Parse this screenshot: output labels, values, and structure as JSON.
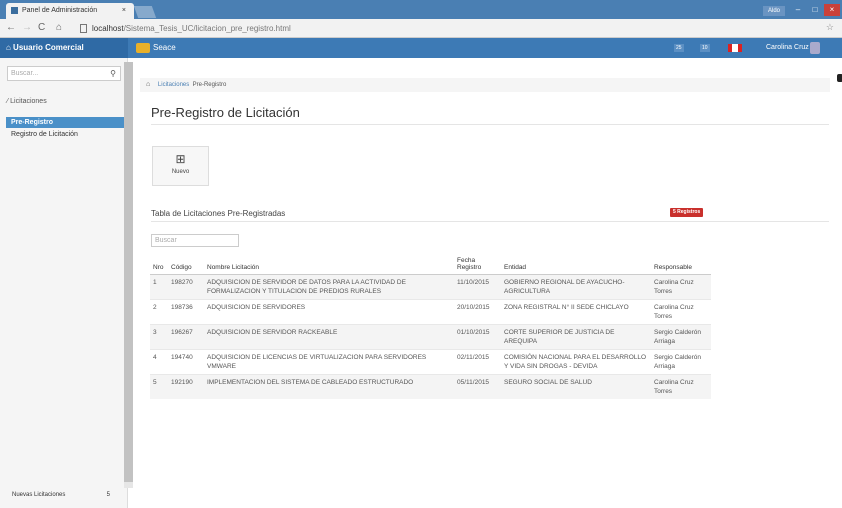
{
  "browser": {
    "tab_title": "Panel de Administración",
    "tab_close": "×",
    "url_host": "localhost",
    "url_path": "/Sistema_Tesis_UC/licitacion_pre_registro.html",
    "user_badge": "Aldo",
    "win_min": "–",
    "win_max": "□",
    "win_close": "×"
  },
  "topbar": {
    "brand": "⌂ Usuario Comercial",
    "seace": "Seace",
    "badge1": "25",
    "badge2": "10",
    "user_name": "Carolina Cruz"
  },
  "sidebar": {
    "search_placeholder": "Buscar...",
    "section": "Licitaciones",
    "items": [
      {
        "label": "Pre-Registro"
      },
      {
        "label": "Registro de Licitación"
      }
    ],
    "footer_label": "Nuevas Licitaciones",
    "footer_count": "5"
  },
  "breadcrumb": {
    "level1": "Licitaciones",
    "level2": "Pre-Registro"
  },
  "page": {
    "title": "Pre-Registro de Licitación",
    "new_button": "Nuevo",
    "table_title": "Tabla de Licitaciones Pre-Registradas",
    "registros_badge": "5 Registros",
    "search_placeholder": "Buscar"
  },
  "table": {
    "headers": [
      "Nro",
      "Código",
      "Nombre Licitación",
      "Fecha Registro",
      "Entidad",
      "Responsable"
    ],
    "rows": [
      {
        "nro": "1",
        "codigo": "198270",
        "nombre": "ADQUISICION DE SERVIDOR DE DATOS PARA LA ACTIVIDAD DE FORMALIZACION Y TITULACION DE PREDIOS RURALES",
        "fecha": "11/10/2015",
        "entidad": "GOBIERNO REGIONAL DE AYACUCHO-AGRICULTURA",
        "responsable": "Carolina Cruz Torres"
      },
      {
        "nro": "2",
        "codigo": "198736",
        "nombre": "ADQUISICION DE SERVIDORES",
        "fecha": "20/10/2015",
        "entidad": "ZONA REGISTRAL N° II SEDE CHICLAYO",
        "responsable": "Carolina Cruz Torres"
      },
      {
        "nro": "3",
        "codigo": "196267",
        "nombre": "ADQUISICION DE SERVIDOR RACKEABLE",
        "fecha": "01/10/2015",
        "entidad": "CORTE SUPERIOR DE JUSTICIA DE AREQUIPA",
        "responsable": "Sergio Calderón Arriaga"
      },
      {
        "nro": "4",
        "codigo": "194740",
        "nombre": "ADQUISICION DE LICENCIAS DE VIRTUALIZACION PARA SERVIDORES VMWARE",
        "fecha": "02/11/2015",
        "entidad": "COMISIÓN NACIONAL PARA EL DESARROLLO Y VIDA SIN DROGAS - DEVIDA",
        "responsable": "Sergio Calderón Arriaga"
      },
      {
        "nro": "5",
        "codigo": "192190",
        "nombre": "IMPLEMENTACION DEL SISTEMA DE CABLEADO ESTRUCTURADO",
        "fecha": "05/11/2015",
        "entidad": "SEGURO SOCIAL DE SALUD",
        "responsable": "Carolina Cruz Torres"
      }
    ]
  },
  "colors": {
    "topbar": "#3d7ab5",
    "active": "#4a90c8",
    "badge": "#c9302c"
  }
}
